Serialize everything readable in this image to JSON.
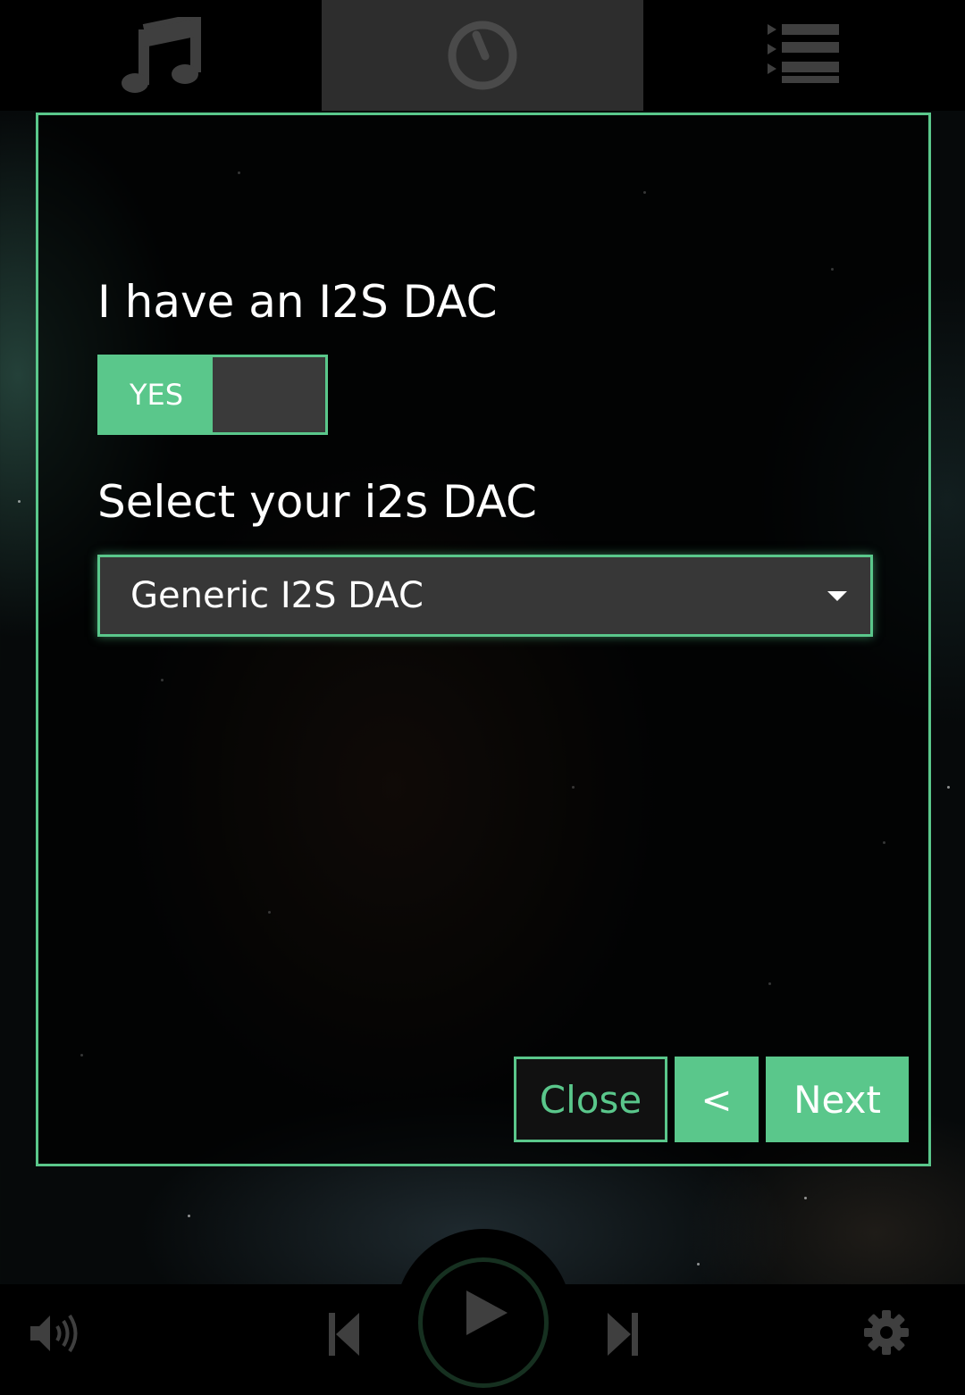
{
  "top_nav": {
    "tabs": [
      {
        "icon": "music-note-icon",
        "active": false
      },
      {
        "icon": "clock-icon",
        "active": true
      },
      {
        "icon": "queue-list-icon",
        "active": false
      }
    ]
  },
  "wizard": {
    "i2s_label": "I have an I2S DAC",
    "toggle_label": "YES",
    "select_label": "Select your i2s DAC",
    "dac_selected": "Generic I2S DAC",
    "close_label": "Close",
    "prev_label": "<",
    "next_label": "Next"
  },
  "player": {
    "icons": [
      "volume-icon",
      "previous-track-icon",
      "play-icon",
      "next-track-icon",
      "settings-gear-icon"
    ]
  },
  "colors": {
    "accent": "#5ac78b",
    "panel": "#373737",
    "icon_gray": "#3f3f3f"
  }
}
